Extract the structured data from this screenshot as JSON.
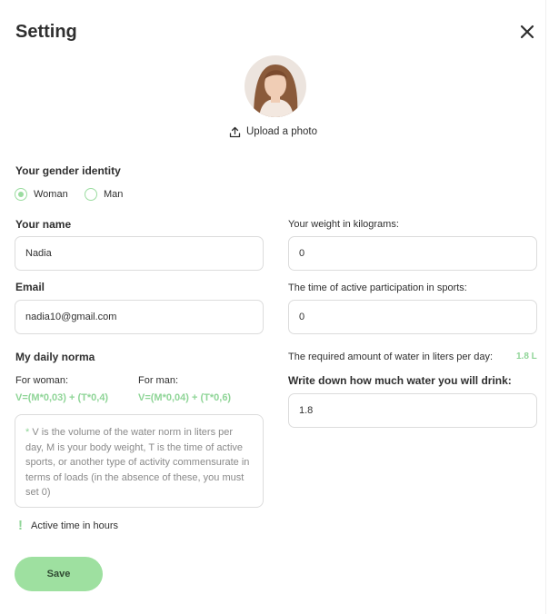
{
  "header": {
    "title": "Setting"
  },
  "photo": {
    "upload_label": "Upload a photo"
  },
  "gender": {
    "label": "Your gender identity",
    "options": [
      "Woman",
      "Man"
    ],
    "selected": "Woman"
  },
  "name": {
    "label": "Your name",
    "value": "Nadia"
  },
  "email": {
    "label": "Email",
    "value": "nadia10@gmail.com"
  },
  "weight": {
    "label": "Your weight in kilograms:",
    "value": "0"
  },
  "sport_time": {
    "label": "The time of active participation in sports:",
    "value": "0"
  },
  "daily_norma": {
    "label": "My daily norma",
    "woman_caption": "For woman:",
    "woman_formula": "V=(M*0,03) + (T*0,4)",
    "man_caption": "For man:",
    "man_formula": "V=(M*0,04) + (T*0,6)",
    "note_star": "*",
    "note": "V is the volume of the water norm in liters per day, M is your body weight, T is the time of active sports, or another type of activity commensurate in terms of loads (in the absence of these, you must set 0)",
    "hint_mark": "!",
    "hint": "Active time in hours"
  },
  "required": {
    "label": "The required amount of water in liters per day:",
    "value": "1.8 L"
  },
  "drink": {
    "label": "Write down how much water you will drink:",
    "value": "1.8"
  },
  "actions": {
    "save_label": "Save"
  },
  "colors": {
    "accent": "#9ee0a0",
    "accent_text": "#8fd597",
    "border": "#dcdcdc",
    "text": "#2f2f2f"
  }
}
